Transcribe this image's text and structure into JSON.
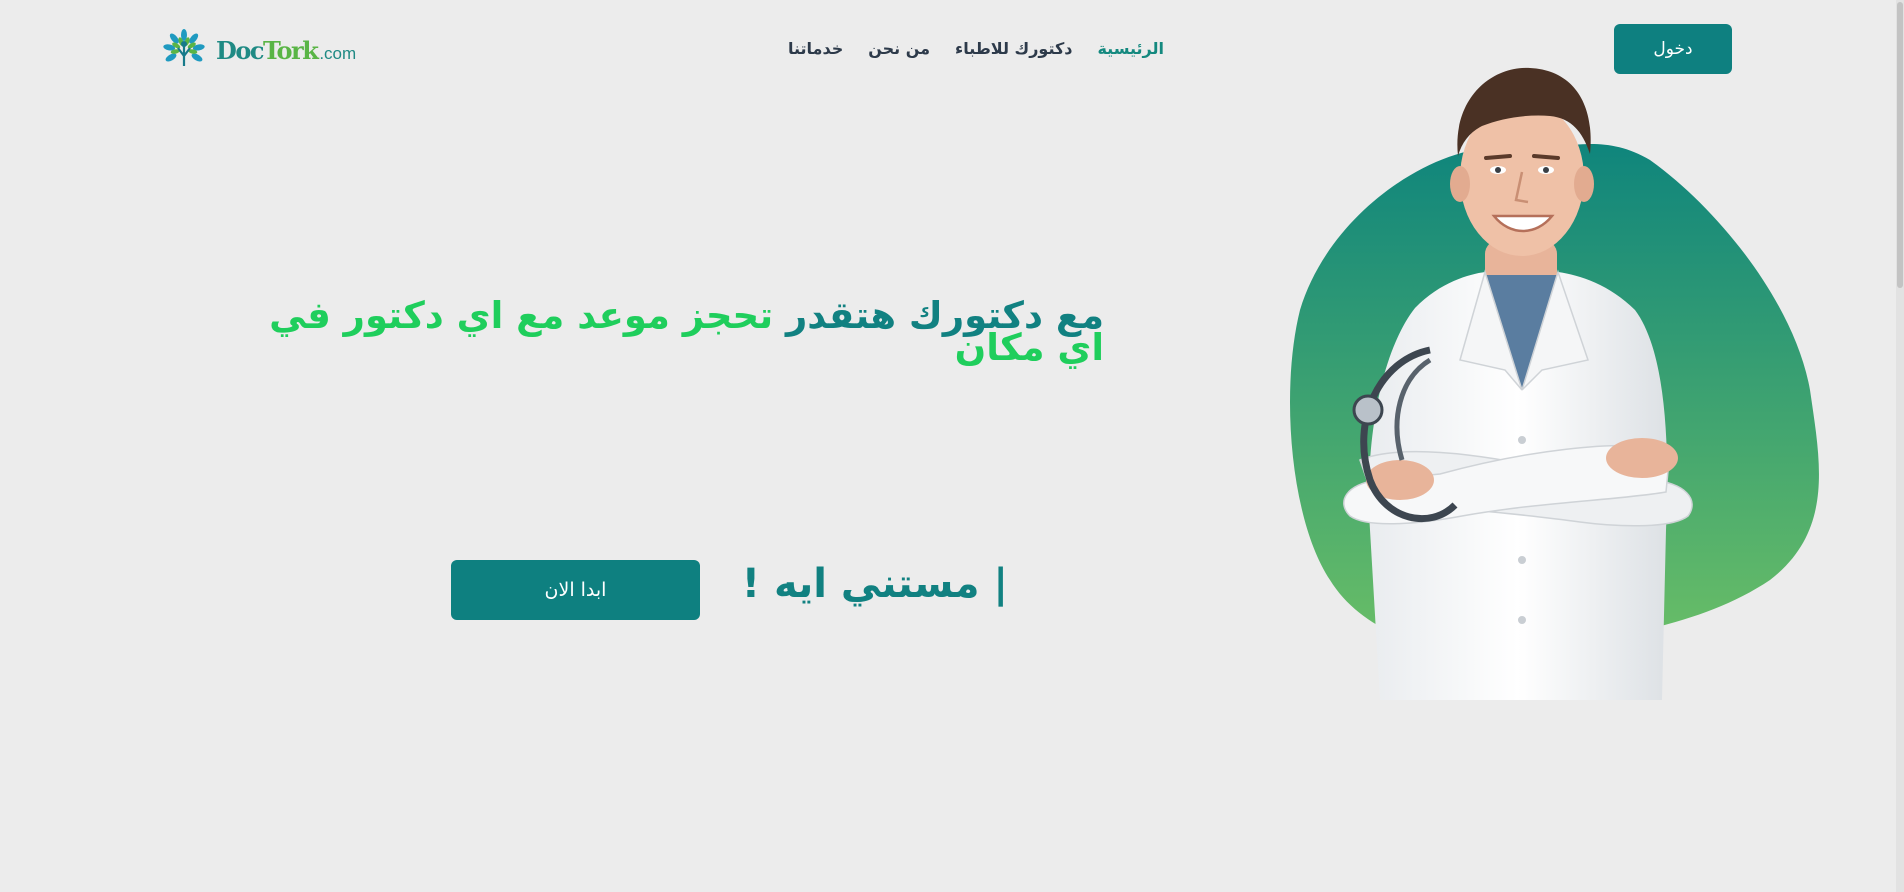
{
  "logo": {
    "brand_part1": "Doc",
    "brand_part2": "Tork",
    "brand_domain": ".com",
    "icon": "tree-of-life-icon",
    "colors": {
      "primary": "#1f8a84",
      "secondary": "#5ab546"
    }
  },
  "nav": {
    "items": [
      {
        "label": "الرئيسية",
        "active": true
      },
      {
        "label": "دكتورك للاطباء",
        "active": false
      },
      {
        "label": "من نحن",
        "active": false
      },
      {
        "label": "خدماتنا",
        "active": false
      }
    ]
  },
  "header": {
    "login_label": "دخول"
  },
  "hero": {
    "title_part1": "مع دكتورك هتقدر ",
    "title_part2": "تحجز موعد مع اي دكتور في اي مكان",
    "question": "| مستني ايه !",
    "cta_label": "ابدا الان",
    "image": "smiling-doctor-with-stethoscope",
    "blob_gradient": [
      "#0f857c",
      "#6bbf66"
    ]
  },
  "theme": {
    "accent": "#0e8080",
    "highlight": "#1fce5c",
    "background": "#ececec"
  }
}
